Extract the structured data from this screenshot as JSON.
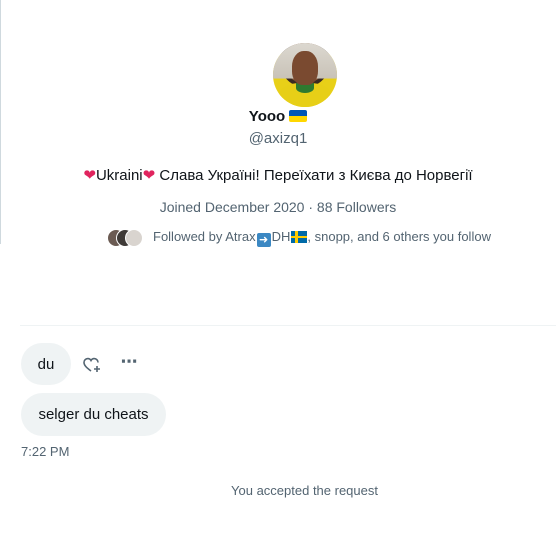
{
  "profile": {
    "name": "Yooo",
    "handle": "@axizq1",
    "bio_country": "Ukraini",
    "bio_text": "Слава Україні! Переїхати з Києва до Норвегії",
    "joined": "Joined December 2020 · 88 Followers",
    "followed_prefix": "Followed by Atrax",
    "followed_dh": "DH",
    "followed_suffix": ", snopp, and 6 others you follow",
    "colors": {
      "heart": "#e0245e",
      "flag_ua_top": "#0057b7",
      "flag_ua_bottom": "#ffd700"
    }
  },
  "messages": [
    {
      "text": "du"
    },
    {
      "text": "selger du cheats"
    }
  ],
  "timestamp": "7:22 PM",
  "notice": "You accepted the request",
  "icons": {
    "react": "heart-plus-icon",
    "more": "more-icon",
    "arrow": "arrow-right-icon"
  }
}
